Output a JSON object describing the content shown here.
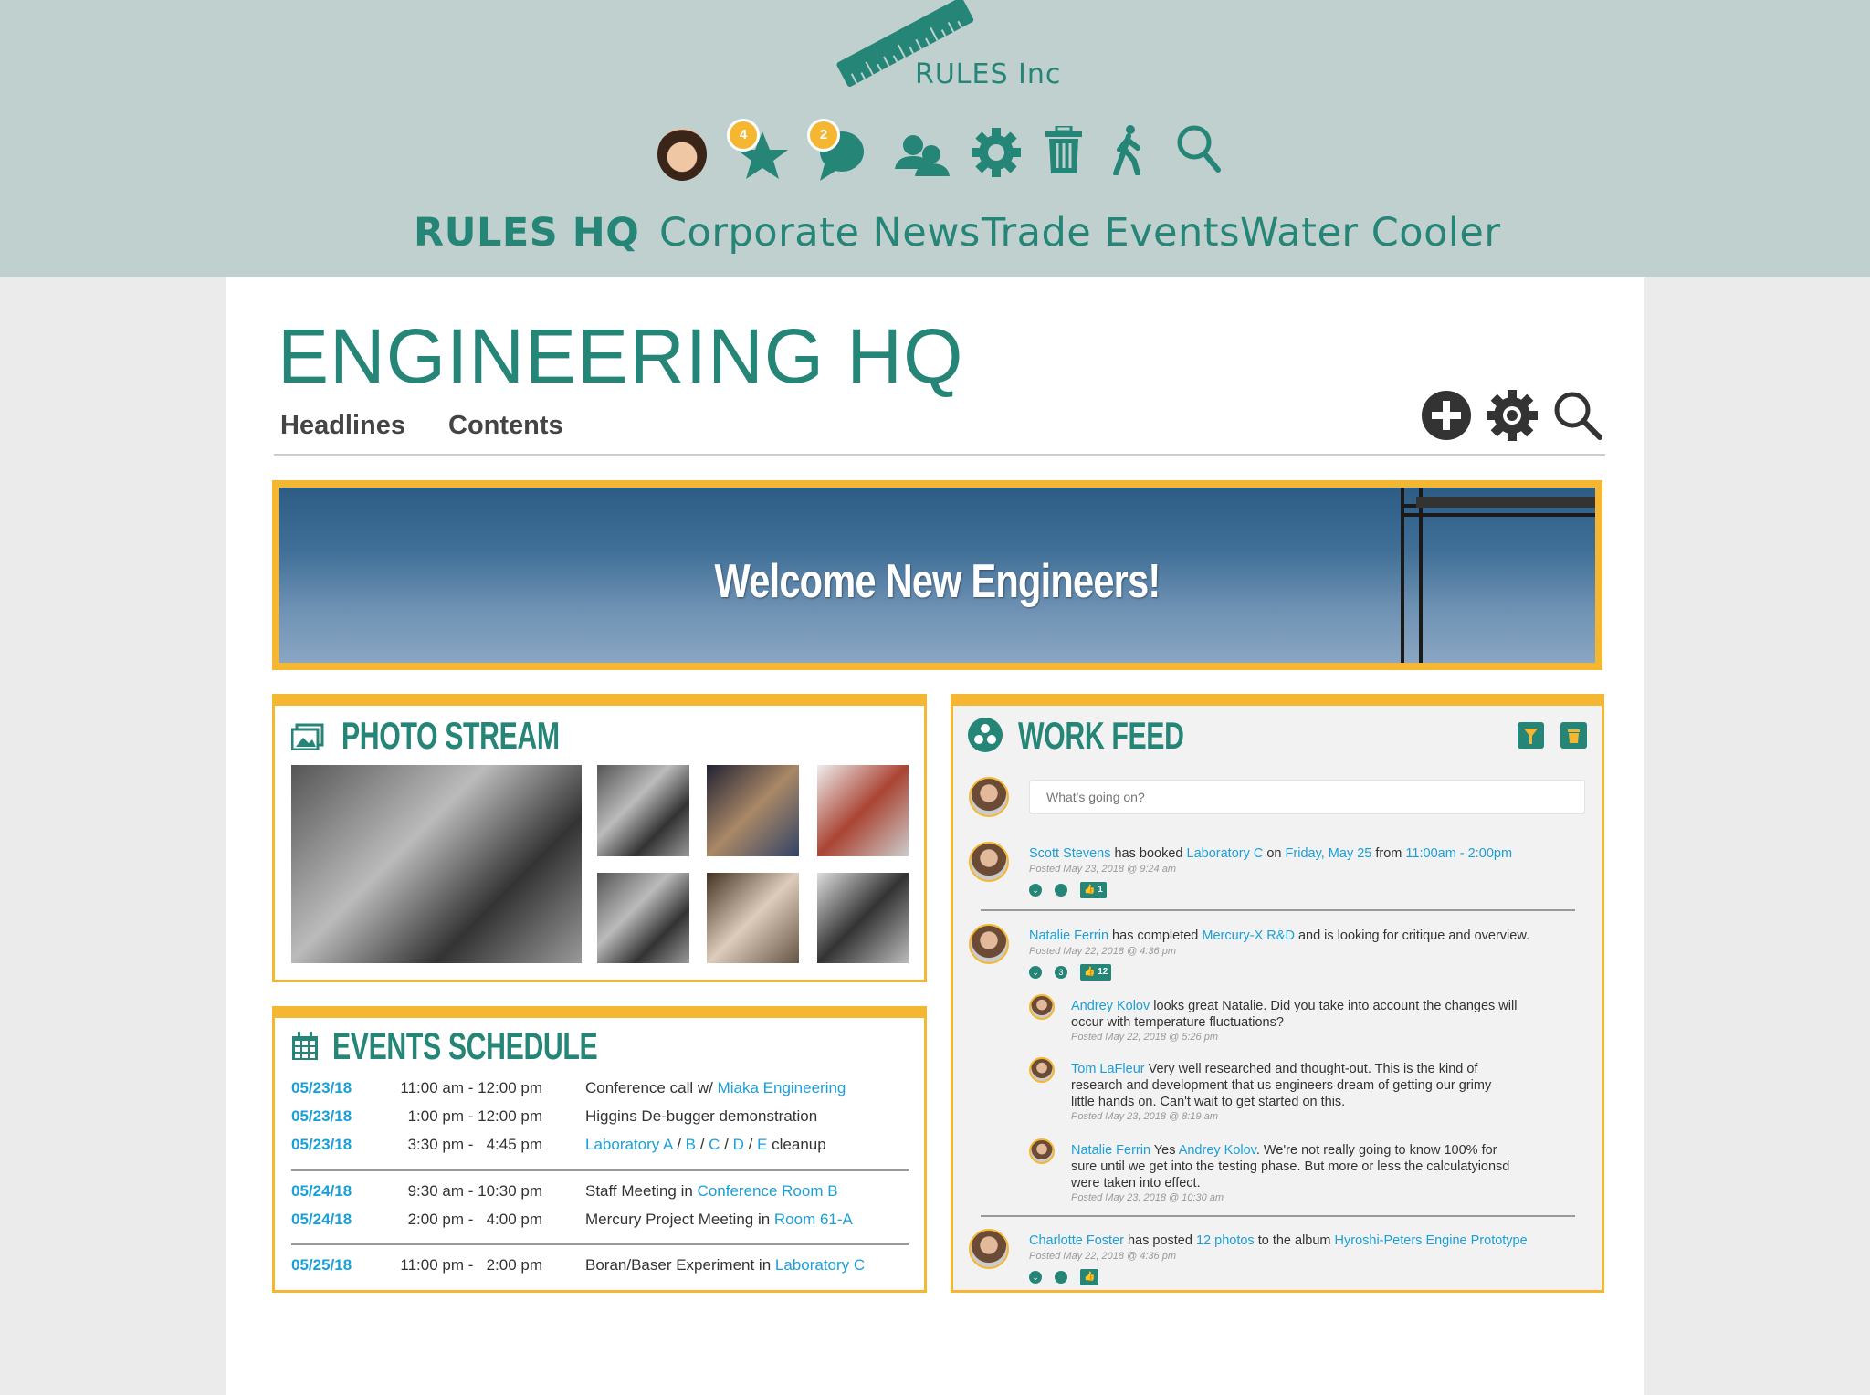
{
  "brand": {
    "name": "RULES Inc"
  },
  "header_icons": {
    "favorites_count": "4",
    "messages_count": "2",
    "icons": [
      "user-avatar",
      "star-icon",
      "chat-icon",
      "users-icon",
      "gear-icon",
      "trash-icon",
      "walking-icon",
      "search-icon"
    ]
  },
  "nav": [
    "RULES HQ",
    "Corporate News",
    "Trade Events",
    "Water Cooler"
  ],
  "page": {
    "title": "ENGINEERING HQ",
    "tabs": [
      "Headlines",
      "Contents"
    ],
    "actions": [
      "plus-circle-icon",
      "gear-icon",
      "search-icon"
    ]
  },
  "banner": {
    "text": "Welcome New Engineers!"
  },
  "photo_stream": {
    "title": "PHOTO STREAM"
  },
  "events": {
    "title": "EVENTS SCHEDULE",
    "rows": [
      {
        "date": "05/23/18",
        "time": "11:00 am - 12:00 pm",
        "desc": [
          {
            "t": "Conference call w/ "
          },
          {
            "t": "Miaka Engineering",
            "link": true
          }
        ]
      },
      {
        "date": "05/23/18",
        "time": "1:00 pm - 12:00 pm",
        "desc": [
          {
            "t": "Higgins De-bugger demonstration"
          }
        ]
      },
      {
        "date": "05/23/18",
        "time": "3:30 pm -   4:45 pm",
        "desc": [
          {
            "t": "Laboratory A",
            "link": true
          },
          {
            "t": " / "
          },
          {
            "t": "B",
            "link": true
          },
          {
            "t": " / "
          },
          {
            "t": "C",
            "link": true
          },
          {
            "t": " / "
          },
          {
            "t": "D",
            "link": true
          },
          {
            "t": " / "
          },
          {
            "t": "E",
            "link": true
          },
          {
            "t": " cleanup"
          }
        ]
      },
      {
        "date": "05/24/18",
        "time": "9:30 am - 10:30 pm",
        "desc": [
          {
            "t": "Staff Meeting in "
          },
          {
            "t": "Conference Room B",
            "link": true
          }
        ]
      },
      {
        "date": "05/24/18",
        "time": "2:00 pm -   4:00 pm",
        "desc": [
          {
            "t": "Mercury Project Meeting in "
          },
          {
            "t": "Room 61-A",
            "link": true
          }
        ]
      },
      {
        "date": "05/25/18",
        "time": "11:00 pm -   2:00 pm",
        "desc": [
          {
            "t": "Boran/Baser Experiment in "
          },
          {
            "t": "Laboratory C",
            "link": true
          }
        ]
      }
    ]
  },
  "work_feed": {
    "title": "WORK FEED",
    "input_placeholder": "What's going on?",
    "posts": [
      {
        "text": [
          {
            "t": "Scott Stevens",
            "link": true
          },
          {
            "t": " has booked "
          },
          {
            "t": "Laboratory C",
            "link": true
          },
          {
            "t": " on "
          },
          {
            "t": "Friday, May 25",
            "link": true
          },
          {
            "t": " from "
          },
          {
            "t": "11:00am - 2:00pm",
            "link": true
          }
        ],
        "posted": "Posted May 23, 2018 @ 9:24 am",
        "comments": "",
        "likes": "1"
      },
      {
        "text": [
          {
            "t": "Natalie Ferrin",
            "link": true
          },
          {
            "t": " has completed "
          },
          {
            "t": "Mercury-X R&D",
            "link": true
          },
          {
            "t": " and is looking for critique and overview."
          }
        ],
        "posted": "Posted May 22, 2018 @ 4:36 pm",
        "comments": "3",
        "likes": "12"
      },
      {
        "text": [
          {
            "t": "Charlotte Foster",
            "link": true
          },
          {
            "t": " has posted "
          },
          {
            "t": "12 photos",
            "link": true
          },
          {
            "t": " to the album "
          },
          {
            "t": "Hyroshi-Peters Engine Prototype",
            "link": true
          }
        ],
        "posted": "Posted May 22, 2018 @ 4:36 pm",
        "comments": "",
        "likes": ""
      }
    ],
    "replies": [
      {
        "text": [
          {
            "t": "Andrey Kolov",
            "link": true
          },
          {
            "t": " looks great Natalie. Did you take into account the changes will occur with temperature fluctuations?"
          }
        ],
        "posted": "Posted May 22, 2018 @ 5:26 pm"
      },
      {
        "text": [
          {
            "t": "Tom LaFleur",
            "link": true
          },
          {
            "t": " Very well researched and thought-out. This is the kind of research and development that us engineers dream of getting our grimy little hands on. Can't wait to get started on this."
          }
        ],
        "posted": "Posted May 23, 2018 @ 8:19 am"
      },
      {
        "text": [
          {
            "t": "Natalie Ferrin",
            "link": true
          },
          {
            "t": " Yes "
          },
          {
            "t": "Andrey Kolov",
            "link": true
          },
          {
            "t": ". We're not really going to know 100% for sure until we get into the testing phase. But more or less the calculatyionsd were taken into effect."
          }
        ],
        "posted": "Posted May 23, 2018 @ 10:30 am"
      }
    ]
  },
  "colors": {
    "teal": "#258576",
    "accent": "#f5b731",
    "link": "#1a9fd9",
    "header_bg": "#c0d0cf"
  }
}
